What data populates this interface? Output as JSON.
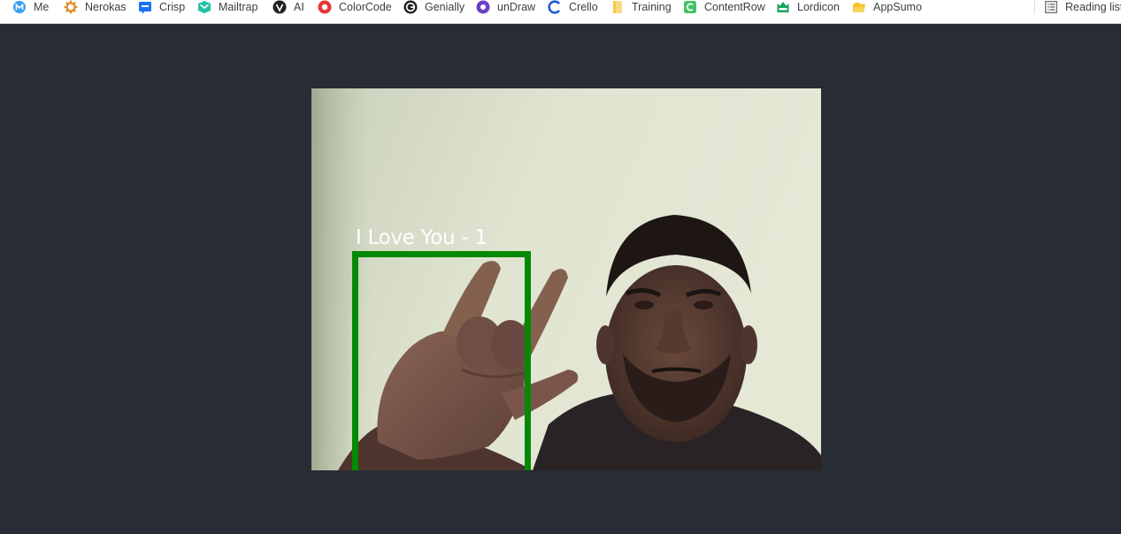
{
  "bookmarks": [
    {
      "label": "Me",
      "icon": "me-icon",
      "color": "#1a73e8"
    },
    {
      "label": "Nerokas",
      "icon": "nerokas-icon",
      "color": "#e0912a"
    },
    {
      "label": "Crisp",
      "icon": "crisp-icon",
      "color": "#1972f5"
    },
    {
      "label": "Mailtrap",
      "icon": "mailtrap-icon",
      "color": "#22c2a6"
    },
    {
      "label": "AI",
      "icon": "ai-icon",
      "color": "#202124"
    },
    {
      "label": "ColorCode",
      "icon": "colorcode-icon",
      "color": "#e53935"
    },
    {
      "label": "Genially",
      "icon": "genially-icon",
      "color": "#202124"
    },
    {
      "label": "unDraw",
      "icon": "undraw-icon",
      "color": "#6c3fc5"
    },
    {
      "label": "Crello",
      "icon": "crello-icon",
      "color": "#1e5bd6"
    },
    {
      "label": "Training",
      "icon": "folder-icon",
      "color": "#f6d36b"
    },
    {
      "label": "ContentRow",
      "icon": "contentrow-icon",
      "color": "#34c759"
    },
    {
      "label": "Lordicon",
      "icon": "lordicon-icon",
      "color": "#1aa260"
    },
    {
      "label": "AppSumo",
      "icon": "folder-icon",
      "color": "#f5c232"
    }
  ],
  "reading_list": {
    "label": "Reading list",
    "icon": "reading-list-icon"
  },
  "detection": {
    "label": "I Love You - 1",
    "box_color": "#058805",
    "label_color": "#ffffff"
  },
  "colors": {
    "page_background": "#282c34",
    "bookmarks_bar_background": "#ffffff"
  }
}
